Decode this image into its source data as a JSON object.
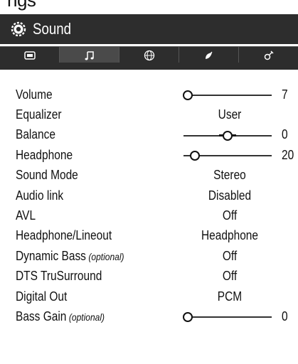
{
  "partial_title": "ngs",
  "header": {
    "title": "Sound",
    "icon": "gear-icon"
  },
  "tabs": [
    {
      "icon": "picture-icon",
      "active": false
    },
    {
      "icon": "music-note-icon",
      "active": true
    },
    {
      "icon": "globe-icon",
      "active": false
    },
    {
      "icon": "satellite-dish-icon",
      "active": false
    },
    {
      "icon": "tools-icon",
      "active": false
    }
  ],
  "rows": [
    {
      "label": "Volume",
      "type": "slider",
      "value": "7",
      "level": 0.05
    },
    {
      "label": "Equalizer",
      "type": "text",
      "value": "User"
    },
    {
      "label": "Balance",
      "type": "slider",
      "value": "0",
      "level": 0.5
    },
    {
      "label": "Headphone",
      "type": "slider",
      "value": "20",
      "level": 0.13
    },
    {
      "label": "Sound Mode",
      "type": "text",
      "value": "Stereo"
    },
    {
      "label": "Audio link",
      "type": "text",
      "value": "Disabled"
    },
    {
      "label": "AVL",
      "type": "text",
      "value": "Off"
    },
    {
      "label": "Headphone/Lineout",
      "type": "text",
      "value": "Headphone"
    },
    {
      "label": "Dynamic Bass",
      "optional": "(optional)",
      "type": "text",
      "value": "Off"
    },
    {
      "label": "DTS TruSurround",
      "type": "text",
      "value": "Off"
    },
    {
      "label": "Digital Out",
      "type": "text",
      "value": "PCM"
    },
    {
      "label": "Bass Gain",
      "optional": "(optional)",
      "type": "slider",
      "value": "0",
      "level": 0.05
    }
  ]
}
